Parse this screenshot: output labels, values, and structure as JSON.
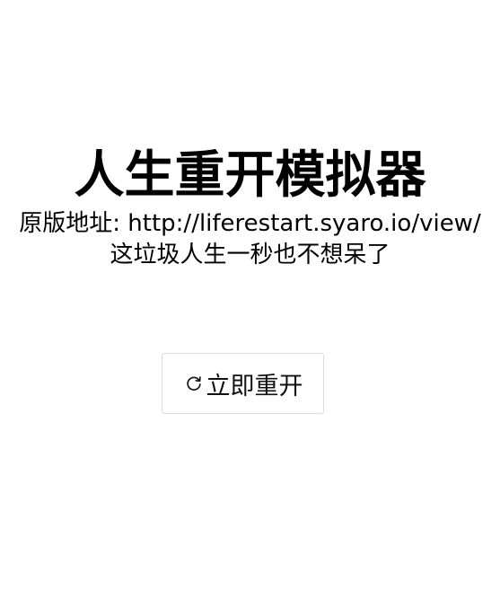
{
  "header": {
    "title": "人生重开模拟器",
    "original_line": "原版地址: http://liferestart.syaro.io/view/",
    "tagline": "这垃圾人生一秒也不想呆了"
  },
  "actions": {
    "restart_label": "立即重开",
    "restart_icon": "refresh-icon"
  },
  "colors": {
    "background": "#ffffff",
    "text": "#000000",
    "button_border": "#dcdcdc"
  }
}
